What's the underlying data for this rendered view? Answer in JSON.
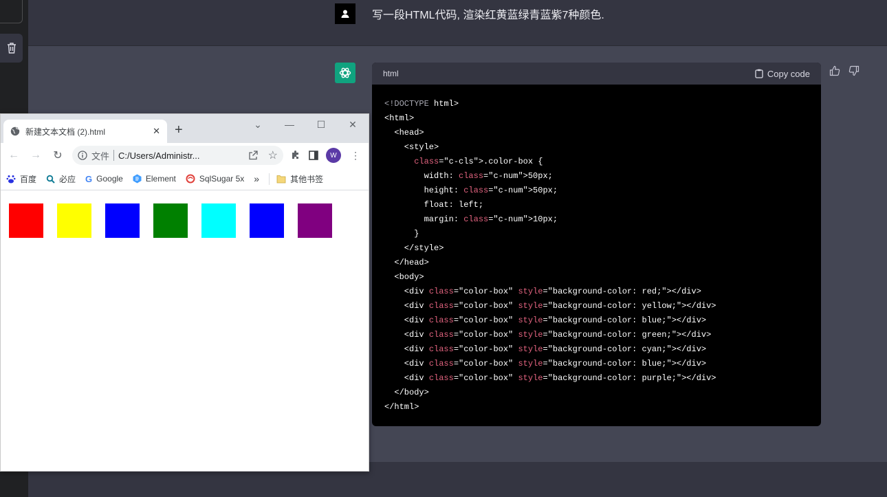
{
  "user_message": "写一段HTML代码, 渲染红黄蓝绿青蓝紫7种颜色.",
  "code_block": {
    "language": "html",
    "copy_label": "Copy code",
    "lines": [
      "<!DOCTYPE html>",
      "<html>",
      "  <head>",
      "    <style>",
      "      .color-box {",
      "        width: 50px;",
      "        height: 50px;",
      "        float: left;",
      "        margin: 10px;",
      "      }",
      "    </style>",
      "  </head>",
      "  <body>",
      "    <div class=\"color-box\" style=\"background-color: red;\"></div>",
      "    <div class=\"color-box\" style=\"background-color: yellow;\"></div>",
      "    <div class=\"color-box\" style=\"background-color: blue;\"></div>",
      "    <div class=\"color-box\" style=\"background-color: green;\"></div>",
      "    <div class=\"color-box\" style=\"background-color: cyan;\"></div>",
      "    <div class=\"color-box\" style=\"background-color: blue;\"></div>",
      "    <div class=\"color-box\" style=\"background-color: purple;\"></div>",
      "  </body>",
      "</html>"
    ]
  },
  "browser": {
    "tab_title": "新建文本文档 (2).html",
    "omnibox_label": "文件",
    "url": "C:/Users/Administr...",
    "profile_initial": "W",
    "bookmarks": [
      {
        "label": "百度",
        "icon": "baidu-icon"
      },
      {
        "label": "必应",
        "icon": "bing-search-icon"
      },
      {
        "label": "Google",
        "icon": "google-icon"
      },
      {
        "label": "Element",
        "icon": "element-icon"
      },
      {
        "label": "SqlSugar 5x",
        "icon": "sqlsugar-icon"
      }
    ],
    "bookmarks_more": "»",
    "other_bookmarks": "其他书签",
    "color_boxes": [
      "#ff0000",
      "#ffff00",
      "#0000ff",
      "#008000",
      "#00ffff",
      "#0000ff",
      "#800080"
    ]
  }
}
